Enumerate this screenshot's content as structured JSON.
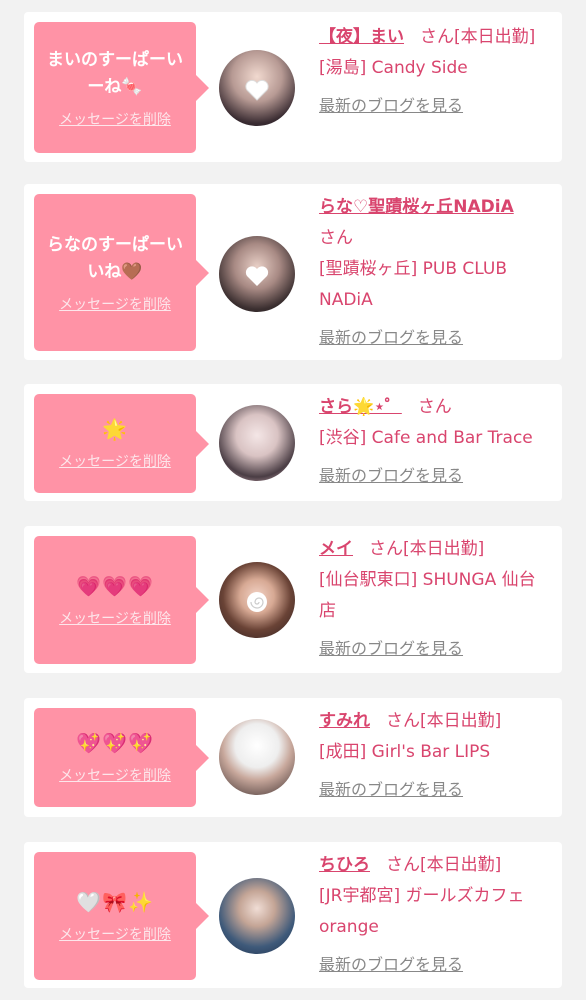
{
  "colors": {
    "background": "#f2f2f2",
    "bubble": "#ff93a6",
    "accent": "#d9456e",
    "link_gray": "#888888"
  },
  "cards": [
    {
      "message": "まいのすーぱーいーね🍬",
      "delete_label": "メッセージを削除",
      "name": "【夜】まい",
      "honorific": "さん",
      "status": "[本日出勤]",
      "shop": "[湯島] Candy Side",
      "blog_label": "最新のブログを見る"
    },
    {
      "message": "らなのすーぱーいいね🤎",
      "delete_label": "メッセージを削除",
      "name": "らな♡聖蹟桜ヶ丘NADiA",
      "honorific": "さん",
      "status": "",
      "shop": "[聖蹟桜ヶ丘] PUB CLUB NADiA",
      "blog_label": "最新のブログを見る"
    },
    {
      "message": "🌟",
      "delete_label": "メッセージを削除",
      "name": "さら🌟⋆゜",
      "honorific": "さん",
      "status": "",
      "shop": "[渋谷] Cafe and Bar Trace",
      "blog_label": "最新のブログを見る"
    },
    {
      "message": "💗💗💗",
      "delete_label": "メッセージを削除",
      "name": "メイ",
      "honorific": "さん",
      "status": "[本日出勤]",
      "shop": "[仙台駅東口] SHUNGA 仙台店",
      "blog_label": "最新のブログを見る"
    },
    {
      "message": "💖💖💖",
      "delete_label": "メッセージを削除",
      "name": "すみれ",
      "honorific": "さん",
      "status": "[本日出勤]",
      "shop": "[成田] Girl's Bar LIPS",
      "blog_label": "最新のブログを見る"
    },
    {
      "message": "🤍🎀✨",
      "delete_label": "メッセージを削除",
      "name": "ちひろ",
      "honorific": "さん",
      "status": "[本日出勤]",
      "shop": "[JR宇都宮] ガールズカフェ orange",
      "blog_label": "最新のブログを見る"
    }
  ]
}
